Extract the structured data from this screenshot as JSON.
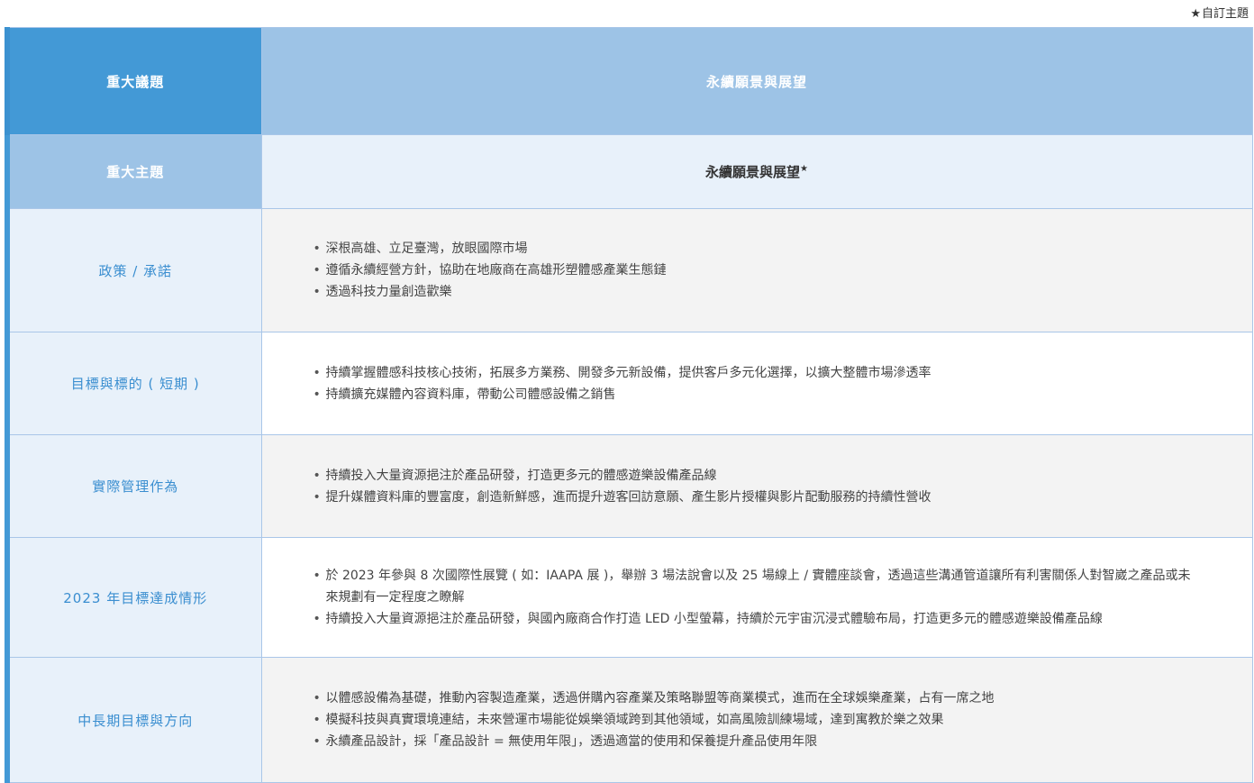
{
  "legend": {
    "star": "★",
    "text": "自訂主題"
  },
  "header": {
    "label": "重大議題",
    "value": "永續願景與展望"
  },
  "topic": {
    "label": "重大主題",
    "value": "永續願景與展望",
    "mark": "★"
  },
  "rows": [
    {
      "label": "政策 / 承諾",
      "items": [
        "深根高雄、立足臺灣，放眼國際市場",
        "遵循永續經營方針，協助在地廠商在高雄形塑體感產業生態鏈",
        "透過科技力量創造歡樂"
      ]
    },
    {
      "label": "目標與標的 ( 短期 )",
      "items": [
        "持續掌握體感科技核心技術，拓展多方業務、開發多元新設備，提供客戶多元化選擇，以擴大整體市場滲透率",
        "持續擴充媒體內容資料庫，帶動公司體感設備之銷售"
      ]
    },
    {
      "label": "實際管理作為",
      "items": [
        "持續投入大量資源挹注於產品研發，打造更多元的體感遊樂設備產品線",
        "提升媒體資料庫的豐富度，創造新鮮感，進而提升遊客回訪意願、產生影片授權與影片配動服務的持續性營收"
      ]
    },
    {
      "label": "2023 年目標達成情形",
      "items": [
        "於 2023 年參與 8 次國際性展覽 ( 如：IAAPA 展 )，舉辦 3 場法說會以及 25 場線上 / 實體座談會，透過這些溝通管道讓所有利害關係人對智崴之產品或未來規劃有一定程度之瞭解",
        "持續投入大量資源挹注於產品研發，與國內廠商合作打造 LED 小型螢幕，持續於元宇宙沉浸式體驗布局，打造更多元的體感遊樂設備產品線"
      ]
    },
    {
      "label": "中長期目標與方向",
      "items": [
        "以體感設備為基礎，推動內容製造產業，透過併購內容產業及策略聯盟等商業模式，進而在全球娛樂產業，占有一席之地",
        "模擬科技與真實環境連結，未來營運市場能從娛樂領域跨到其他領域，如高風險訓練場域，達到寓教於樂之效果",
        "永續產品設計，採「產品設計 = 無使用年限」，透過適當的使用和保養提升產品使用年限"
      ]
    }
  ]
}
